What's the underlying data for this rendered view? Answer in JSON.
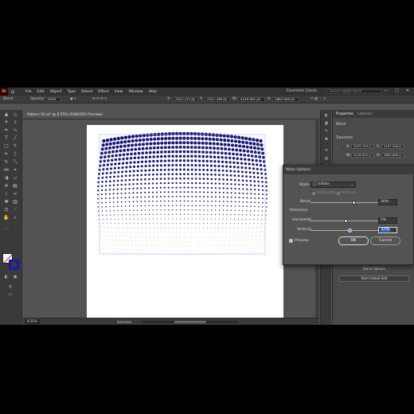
{
  "app": {
    "logo_text": "Ai",
    "menus": [
      "File",
      "Edit",
      "Object",
      "Type",
      "Select",
      "Effect",
      "View",
      "Window",
      "Help"
    ],
    "workspace": "Essentials Classic",
    "search_placeholder": "Search Adobe Stock",
    "window_buttons": [
      "—",
      "□",
      "✕"
    ]
  },
  "control_bar": {
    "selection_label": "Blend",
    "opacity_label": "Opacity:",
    "opacity_value": "100%",
    "x_value": "2425.155 px",
    "y_value": "2167.348 px",
    "w_value": "4149.402 px",
    "h_value": "2883.669 px"
  },
  "document": {
    "tab_title": "Pattern 02.ai* @ 8.55% (RGB/GPU Preview)",
    "close": "✕",
    "zoom": "8.55%",
    "status_tool": "Selection"
  },
  "properties_panel": {
    "tabs": [
      "Properties",
      "Libraries"
    ],
    "object_type": "Blend",
    "transform_label": "Transform",
    "x": "2425.155 p",
    "y": "2167.348 p",
    "w": "4149.402 p",
    "h": "2883.669 p",
    "blend_options_button": "Blend Options",
    "global_edit_button": "Start Global Edit"
  },
  "warp_dialog": {
    "title": "Warp Options",
    "style_label": "Style:",
    "style_value": "Inflate",
    "horizontal_radio": "Horizontal",
    "vertical_radio": "Vertical",
    "bend_label": "Bend:",
    "bend_value": "30%",
    "bend_fraction": 0.65,
    "distortion_label": "Distortion",
    "horizontal_label": "Horizontal:",
    "horizontal_value": "5%",
    "horizontal_fraction": 0.525,
    "vertical_label": "Vertical:",
    "vertical_value": "17%",
    "vertical_fraction": 0.585,
    "preview_label": "Preview",
    "preview_checked": true,
    "ok_label": "OK",
    "cancel_label": "Cancel"
  },
  "colors": {
    "dot_color": "#1a1a75",
    "stroke_swatch": "#1a1aa6",
    "dialog_accent": "#3d8be8"
  }
}
